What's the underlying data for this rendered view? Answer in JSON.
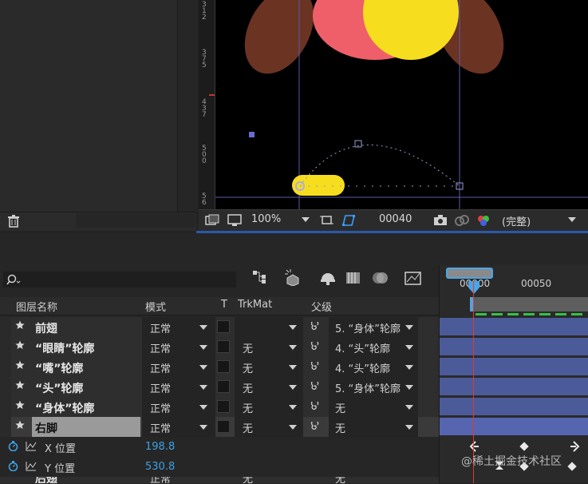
{
  "viewer": {
    "zoom": "100%",
    "timecode": "00040",
    "resolution": "(完整)",
    "ruler_labels": [
      "3\n1\n2",
      "3\n7\n5",
      "4\n3\n7",
      "5\n0\n0",
      "5\n6"
    ]
  },
  "timeline": {
    "headers": {
      "layer_name": "图层名称",
      "mode": "模式",
      "t": "T",
      "trkmat": "TrkMat",
      "parent": "父级"
    },
    "ruler": {
      "t0": "00000",
      "t50": "00050"
    },
    "layers": [
      {
        "name": "前翅",
        "mode": "正常",
        "trkmat": "",
        "parent": "5. “身体”轮廓"
      },
      {
        "name": "“眼睛”轮廓",
        "mode": "正常",
        "trkmat": "无",
        "parent": "4. “头”轮廓"
      },
      {
        "name": "“嘴”轮廓",
        "mode": "正常",
        "trkmat": "无",
        "parent": "4. “头”轮廓"
      },
      {
        "name": "“头”轮廓",
        "mode": "正常",
        "trkmat": "无",
        "parent": "5. “身体”轮廓"
      },
      {
        "name": "“身体”轮廓",
        "mode": "正常",
        "trkmat": "无",
        "parent": "无"
      },
      {
        "name": "右脚",
        "mode": "正常",
        "trkmat": "无",
        "parent": "无"
      }
    ],
    "properties": [
      {
        "name": "X 位置",
        "value": "198.8"
      },
      {
        "name": "Y 位置",
        "value": "530.8"
      }
    ],
    "partial_row": {
      "name": "后翅",
      "mode": "正常",
      "trkmat": "无",
      "parent": "无"
    }
  },
  "watermark": "@稀土掘金技术社区",
  "colors": {
    "accent": "#2b59a8",
    "track": "#4b5a98",
    "value": "#3ea0e3",
    "playhead": "#e3382f"
  }
}
